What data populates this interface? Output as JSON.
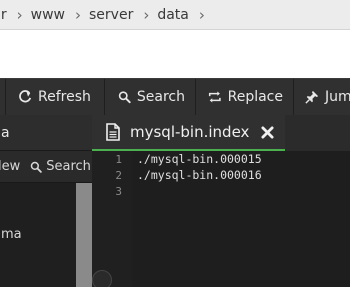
{
  "breadcrumb": [
    {
      "label": "ir"
    },
    {
      "label": "www"
    },
    {
      "label": "server"
    },
    {
      "label": "data"
    }
  ],
  "toolbar": {
    "refresh": "Refresh",
    "search": "Search",
    "replace": "Replace",
    "jump": "Jump"
  },
  "left_panel": {
    "title": "a",
    "new_label": "lew",
    "search_label": "Search",
    "items": [
      "ma"
    ]
  },
  "editor": {
    "tab_label": "mysql-bin.index",
    "accent": "#4caf50",
    "line_numbers": [
      "1",
      "2",
      "3"
    ],
    "lines": [
      "./mysql-bin.000015",
      "./mysql-bin.000016",
      ""
    ]
  }
}
